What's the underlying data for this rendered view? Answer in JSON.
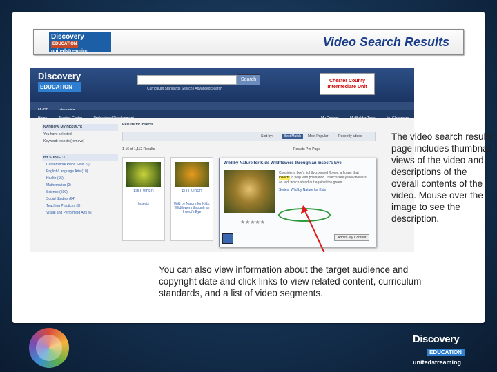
{
  "slide": {
    "title": "Video Search Results",
    "side_paragraph": "The video search results page includes thumbnail views of the video and descriptions of the overall contents of the video. Mouse over the image to see the description.",
    "bottom_paragraph": "You can also view information about the target audience and copyright date and click links to view related content, curriculum standards, and a list of video segments."
  },
  "logos": {
    "header_line1": "Discovery",
    "header_line2": "EDUCATION",
    "header_line3": "unitedstreaming",
    "footer_line1": "Discovery",
    "footer_line2": "EDUCATION",
    "footer_line3": "unitedstreaming"
  },
  "screenshot": {
    "site_logo_line1": "Discovery",
    "site_logo_line2": "EDUCATION",
    "search_button": "Search",
    "search_links": "Curriculum Standards Search  |  Advanced Search",
    "partner": "Chester County Intermediate Unit",
    "nav1": [
      "My DE",
      "streaming"
    ],
    "nav2_left": [
      "Home",
      "Teacher Center",
      "Professional Development"
    ],
    "nav2_right": [
      "My Content",
      "My Builder Tools",
      "My Classroom"
    ],
    "sidebar_head": "NARROW MY RESULTS",
    "sidebar_selected": "You have selected:",
    "sidebar_keyword": "Keyword: insects (remove)",
    "sidebar_subject_head": "BY SUBJECT",
    "sidebar_subjects": [
      "Career/Work Place Skills (9)",
      "English/Language Arts (10)",
      "Health (15)",
      "Mathematics (2)",
      "Science (500)",
      "Social Studies (64)",
      "Teaching Practices (9)",
      "Visual and Performing Arts (6)"
    ],
    "results_title": "Results for insects",
    "sort_label": "Sort by:",
    "sort_options": [
      "Best Match",
      "Most Popular",
      "Recently added"
    ],
    "results_count": "1-16 of 1,112 Results",
    "per_page": "Results Per Page",
    "card1_caption": "FULL VIDEO",
    "card1_title": "Insects",
    "card2_caption": "FULL VIDEO",
    "card2_title": "Wild by Nature for Kids: Wildflowers through an Insect's Eye",
    "popup_title": "Wild by Nature for Kids Wildflowers through an Insect's Eye",
    "popup_desc_pre": "Consider a bee's tightly zoomed flower: a flower that ",
    "popup_desc_mark": "insects",
    "popup_desc_post": " to help with pollination. Insects see yellow flowers as red, which stand out against the green...",
    "popup_series": "Series: Wild by Nature for Kids",
    "popup_stars": "★★★★★",
    "popup_button": "Add to My Content"
  }
}
